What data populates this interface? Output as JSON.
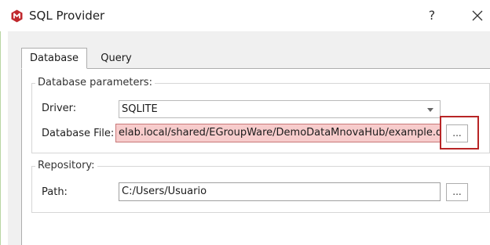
{
  "window": {
    "title": "SQL Provider",
    "help_label": "?",
    "close_label": "X",
    "icon": "app-logo-icon"
  },
  "tabs": [
    {
      "label": "Database",
      "selected": true
    },
    {
      "label": "Query",
      "selected": false
    }
  ],
  "database_parameters": {
    "legend": "Database parameters:",
    "driver": {
      "label": "Driver:",
      "value": "SQLITE"
    },
    "database_file": {
      "label": "Database File:",
      "value": "elab.local/shared/EGroupWare/DemoDataMnovaHub/example.db",
      "browse_label": "..."
    }
  },
  "repository": {
    "legend": "Repository:",
    "path": {
      "label": "Path:",
      "value": "C:/Users/Usuario",
      "browse_label": "..."
    }
  },
  "colors": {
    "accent_highlight": "#b82526",
    "error_field_bg": "#f7cccc",
    "app_icon": "#c0282d"
  }
}
